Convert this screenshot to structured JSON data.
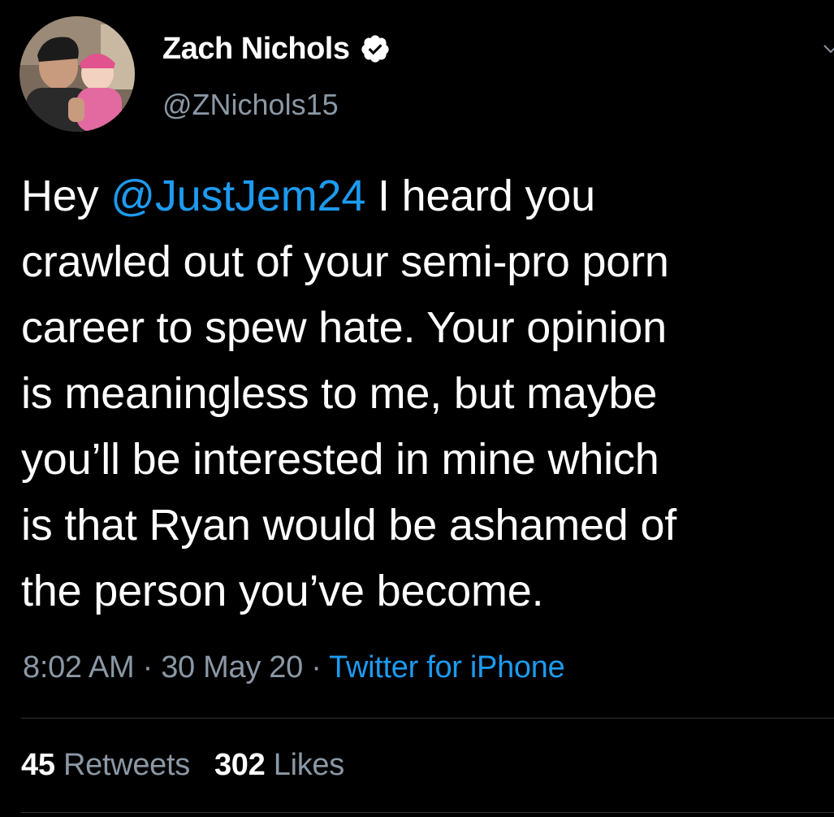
{
  "tweet": {
    "author": {
      "name": "Zach Nichols",
      "handle": "@ZNichols15",
      "verified": true
    },
    "body": {
      "prefix": "Hey ",
      "mention": "@JustJem24",
      "line1_rest": " I heard you",
      "line2": "crawled out of your semi-pro porn",
      "line3": "career to spew hate. Your opinion",
      "line4": "is meaningless to me, but maybe",
      "line5": "you’ll be interested in mine which",
      "line6": "is that Ryan would be ashamed of",
      "line7": "the person you’ve become."
    },
    "meta": {
      "time": "8:02 AM",
      "separator1": " · ",
      "date": "30 May 20",
      "separator2": " · ",
      "source": "Twitter for iPhone"
    },
    "stats": {
      "retweets_count": "45",
      "retweets_label": "Retweets",
      "likes_count": "302",
      "likes_label": "Likes"
    }
  },
  "colors": {
    "background": "#000000",
    "text_primary": "#ffffff",
    "text_secondary": "#8b98a5",
    "link": "#1d9bf0",
    "divider": "#2f3336"
  },
  "icons": {
    "verified": "verified-badge-icon",
    "more": "chevron-down-icon"
  }
}
